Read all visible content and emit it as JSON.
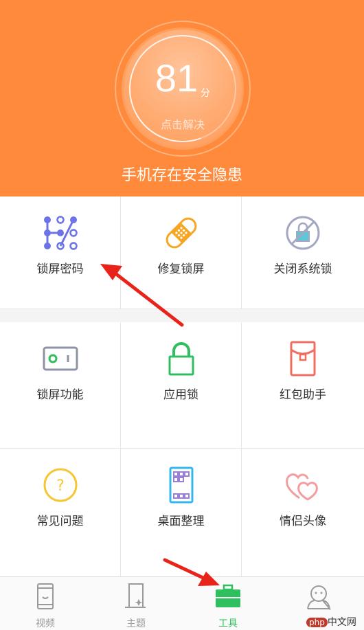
{
  "header": {
    "score": "81",
    "score_unit": "分",
    "action": "点击解决",
    "message": "手机存在安全隐患"
  },
  "grid1": [
    {
      "label": "锁屏密码",
      "icon": "pattern-lock-icon"
    },
    {
      "label": "修复锁屏",
      "icon": "bandage-icon"
    },
    {
      "label": "关闭系统锁",
      "icon": "no-lock-icon"
    }
  ],
  "grid2": [
    {
      "label": "锁屏功能",
      "icon": "toggle-switch-icon"
    },
    {
      "label": "应用锁",
      "icon": "padlock-icon"
    },
    {
      "label": "红包助手",
      "icon": "red-envelope-icon"
    },
    {
      "label": "常见问题",
      "icon": "question-icon"
    },
    {
      "label": "桌面整理",
      "icon": "desktop-grid-icon"
    },
    {
      "label": "情侣头像",
      "icon": "hearts-icon"
    }
  ],
  "tabs": [
    {
      "label": "视频",
      "icon": "video-phone-icon",
      "active": false
    },
    {
      "label": "主题",
      "icon": "theme-icon",
      "active": false
    },
    {
      "label": "工具",
      "icon": "toolbox-icon",
      "active": true
    },
    {
      "label": "",
      "icon": "profile-icon",
      "active": false
    }
  ],
  "watermark": {
    "badge": "php",
    "text": "中文网"
  },
  "colors": {
    "header": "#ff8a3b",
    "active_tab": "#2fbf5e",
    "arrow": "#e8231a"
  }
}
